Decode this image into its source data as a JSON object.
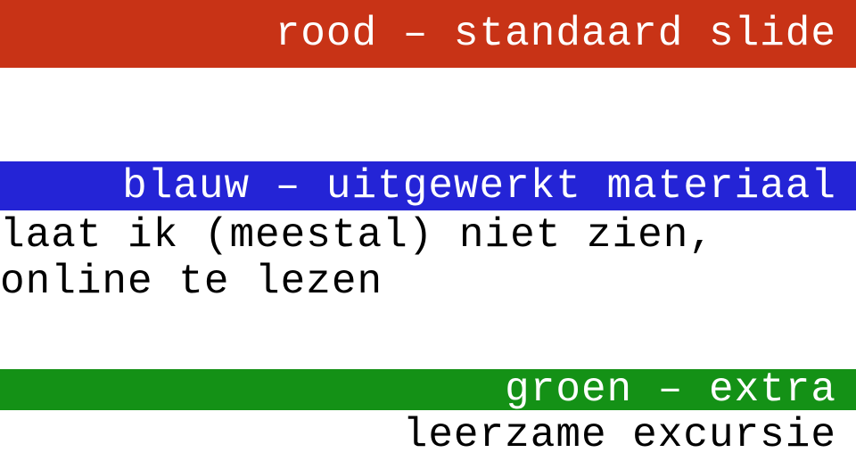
{
  "red": {
    "label": "rood – standaard slide"
  },
  "blue": {
    "label": "blauw – uitgewerkt materiaal",
    "sub": "laat ik (meestal) niet zien, online te lezen"
  },
  "green": {
    "label": "groen – extra",
    "sub": "leerzame excursie"
  }
}
